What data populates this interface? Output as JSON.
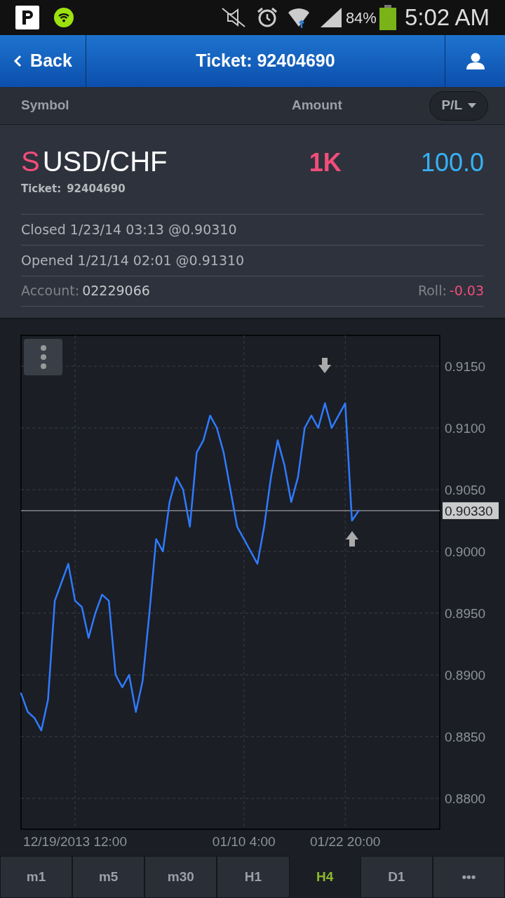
{
  "status_bar": {
    "battery": "84%",
    "time": "5:02 AM"
  },
  "header": {
    "back": "Back",
    "title": "Ticket: 92404690"
  },
  "columns": {
    "symbol": "Symbol",
    "amount": "Amount",
    "sort": "P/L"
  },
  "position": {
    "side": "S",
    "symbol": "USD/CHF",
    "amount": "1K",
    "pl": "100.0",
    "ticket_label": "Ticket:",
    "ticket": "92404690",
    "closed": "Closed 1/23/14 03:13 @0.90310",
    "opened": "Opened 1/21/14 02:01 @0.91310",
    "account_label": "Account:",
    "account": "02229066",
    "roll_label": "Roll:",
    "roll": "-0.03"
  },
  "chart": {
    "chart_data": {
      "type": "line",
      "grid": true,
      "ylim": [
        0.8775,
        0.9175
      ],
      "categories": [
        null,
        null,
        null,
        null,
        null,
        null,
        null,
        null,
        "12/19/2013 12:00",
        null,
        null,
        null,
        null,
        null,
        null,
        null,
        null,
        null,
        null,
        null,
        null,
        null,
        null,
        null,
        null,
        null,
        null,
        null,
        null,
        null,
        null,
        null,
        null,
        "01/10 4:00",
        null,
        null,
        null,
        null,
        null,
        null,
        null,
        null,
        null,
        null,
        null,
        null,
        null,
        null,
        "01/22 20:00",
        null,
        null
      ],
      "series": [
        {
          "color": "#2f7bff",
          "values": [
            0.8885,
            0.887,
            0.8865,
            0.8855,
            0.888,
            0.896,
            0.8975,
            0.899,
            0.896,
            0.8955,
            0.893,
            0.895,
            0.8965,
            0.896,
            0.89,
            0.889,
            0.89,
            0.887,
            0.8895,
            0.895,
            0.901,
            0.9,
            0.904,
            0.906,
            0.905,
            0.902,
            0.908,
            0.909,
            0.911,
            0.91,
            0.908,
            0.905,
            0.902,
            0.901,
            0.9,
            0.899,
            0.902,
            0.906,
            0.909,
            0.907,
            0.904,
            0.906,
            0.91,
            0.911,
            0.91,
            0.912,
            0.91,
            0.911,
            0.912,
            0.9025,
            0.9033
          ]
        }
      ],
      "ref_lines": [
        {
          "axis": "y",
          "value": 0.9033,
          "label": "0.90330",
          "color": "#bbbbbb"
        }
      ],
      "yticks": [
        {
          "value": 0.88,
          "label": "0.8800"
        },
        {
          "value": 0.885,
          "label": "0.8850"
        },
        {
          "value": 0.89,
          "label": "0.8900"
        },
        {
          "value": 0.895,
          "label": "0.8950"
        },
        {
          "value": 0.9,
          "label": "0.9000"
        },
        {
          "value": 0.905,
          "label": "0.9050"
        },
        {
          "value": 0.91,
          "label": "0.9100"
        },
        {
          "value": 0.915,
          "label": "0.9150"
        }
      ]
    }
  },
  "timeframes": [
    {
      "label": "m1",
      "selected": false
    },
    {
      "label": "m5",
      "selected": false
    },
    {
      "label": "m30",
      "selected": false
    },
    {
      "label": "H1",
      "selected": false
    },
    {
      "label": "H4",
      "selected": true
    },
    {
      "label": "D1",
      "selected": false
    },
    {
      "label": "•••",
      "selected": false
    }
  ]
}
